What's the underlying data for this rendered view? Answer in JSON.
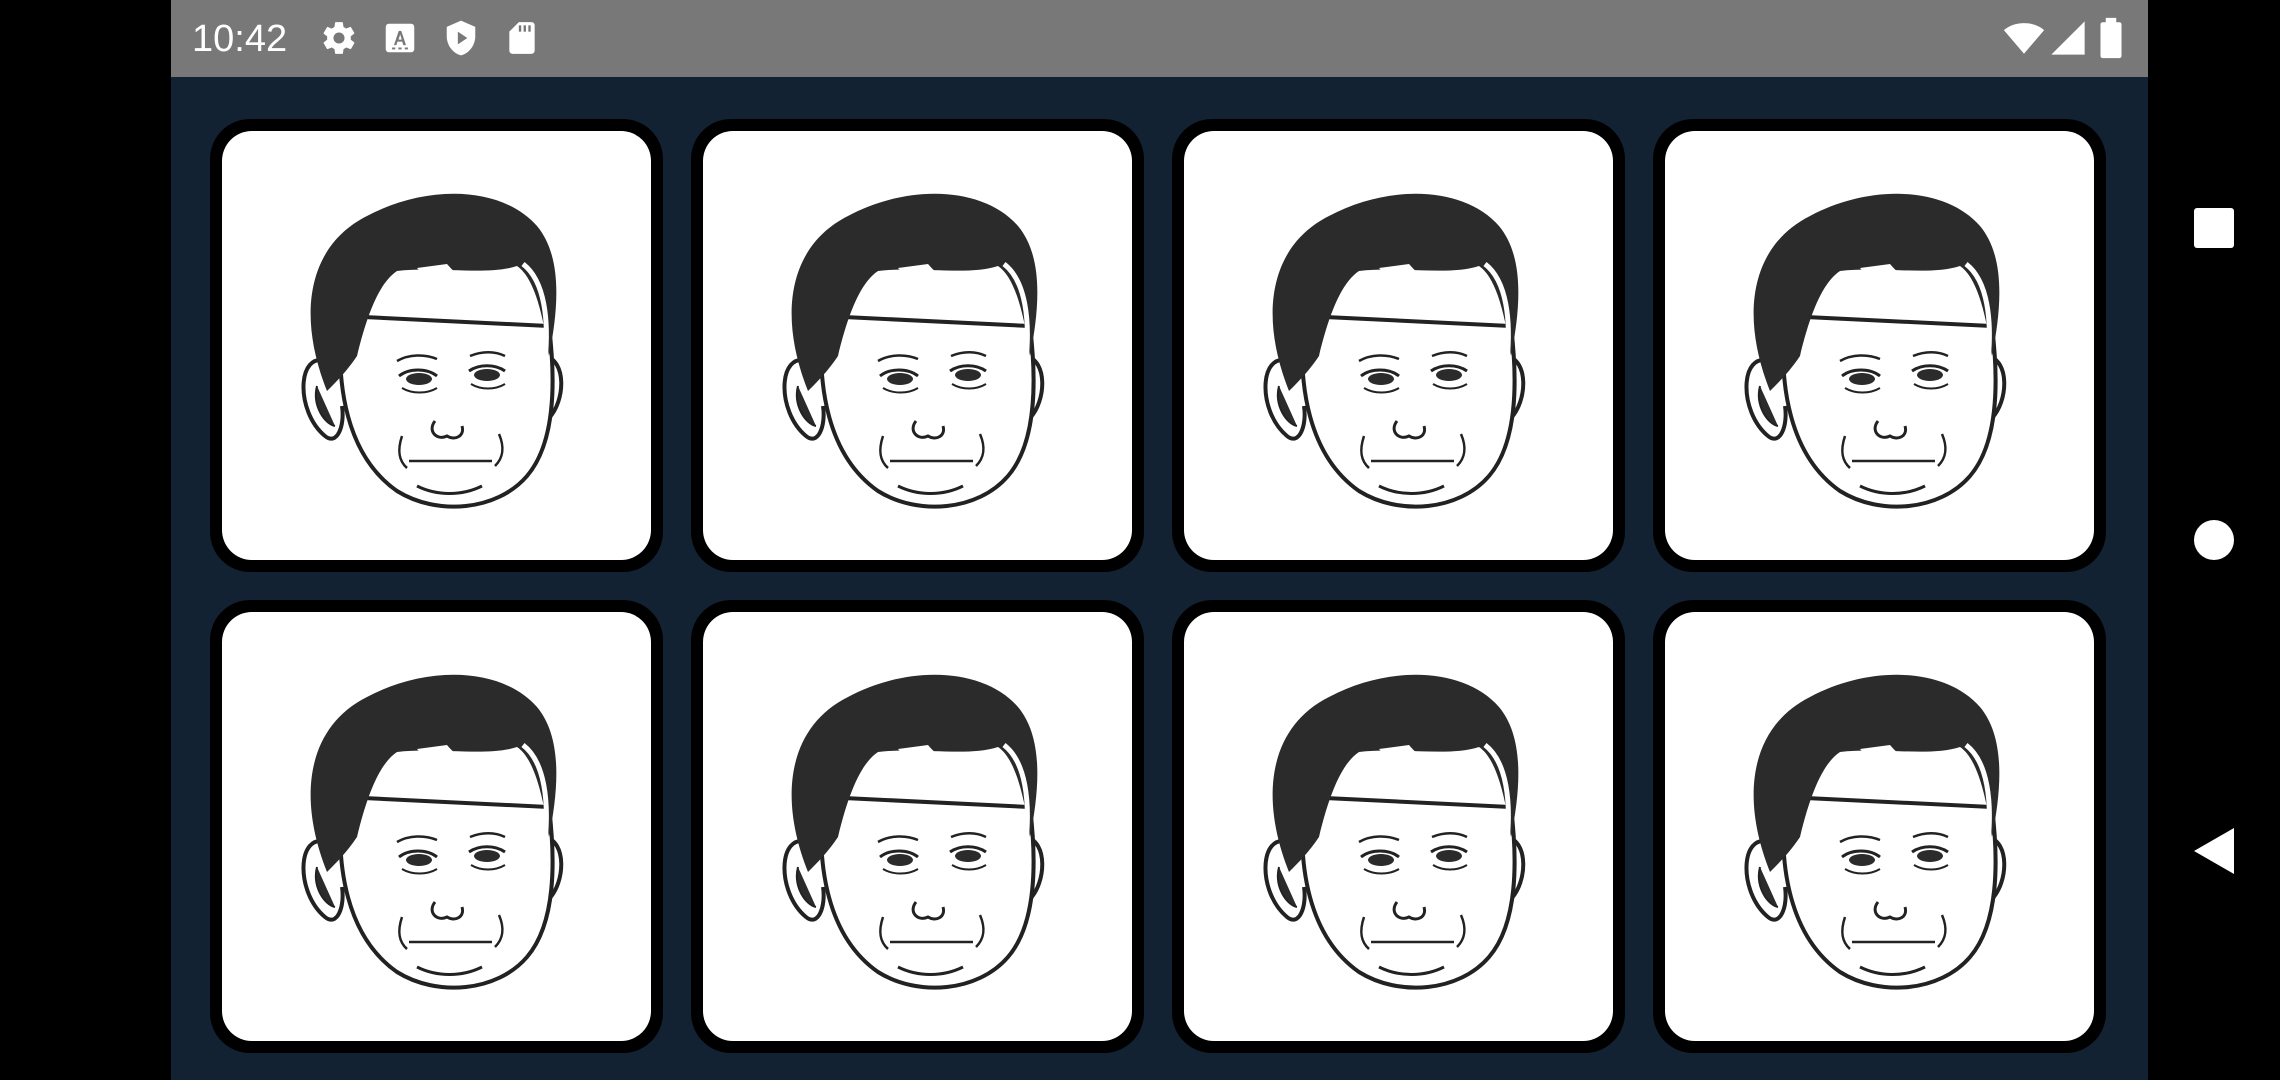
{
  "status_bar": {
    "time": "10:42",
    "left_icons": [
      "gear-icon",
      "text-a-icon",
      "play-protect-icon",
      "sd-card-icon"
    ],
    "right_icons": [
      "wifi-icon",
      "cell-signal-icon",
      "battery-icon"
    ]
  },
  "game": {
    "cards": [
      {
        "face": "old-face-cartoon"
      },
      {
        "face": "old-face-cartoon"
      },
      {
        "face": "old-face-cartoon"
      },
      {
        "face": "old-face-cartoon"
      },
      {
        "face": "old-face-cartoon"
      },
      {
        "face": "old-face-cartoon"
      },
      {
        "face": "old-face-cartoon"
      },
      {
        "face": "old-face-cartoon"
      }
    ]
  },
  "navigation": {
    "buttons": [
      "recents-square-icon",
      "home-circle-icon",
      "back-triangle-icon"
    ]
  },
  "colors": {
    "status_bar": "#787878",
    "app_background": "#132233",
    "card_border": "#000000",
    "card_face": "#ffffff",
    "hair": "#2b2b2b"
  }
}
